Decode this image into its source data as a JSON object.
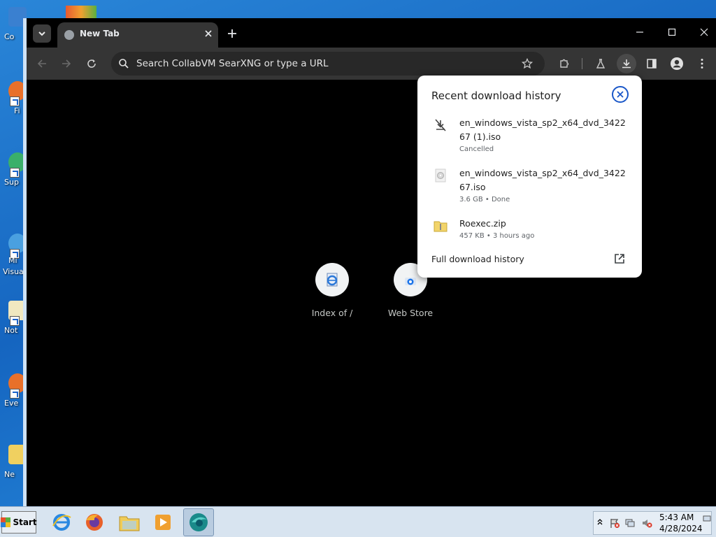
{
  "desktop": {
    "icons": [
      {
        "label": "Co",
        "color": "#3a80d0"
      },
      {
        "label": "Fi",
        "color": "#e8702a"
      },
      {
        "label": "Sup",
        "color": "#3ab06a"
      },
      {
        "label": "Mi",
        "color": "#4aa0e0",
        "label2": "Visua"
      },
      {
        "label": "Not",
        "color": "#f0e8c0"
      },
      {
        "label": "Eve",
        "color": "#e8702a"
      },
      {
        "label": "Ne",
        "color": "#f0d060"
      }
    ]
  },
  "browser": {
    "tab": {
      "title": "New Tab"
    },
    "toolbar": {
      "omnibox_placeholder": "Search CollabVM SearXNG or type a URL"
    },
    "shortcuts": [
      {
        "label": "Index of /"
      },
      {
        "label": "Web Store"
      }
    ]
  },
  "downloads": {
    "title": "Recent download history",
    "items": [
      {
        "name": "en_windows_vista_sp2_x64_dvd_342267 (1).iso",
        "status": "Cancelled"
      },
      {
        "name": "en_windows_vista_sp2_x64_dvd_342267.iso",
        "status": "3.6 GB • Done"
      },
      {
        "name": "Roexec.zip",
        "status": "457 KB • 3 hours ago"
      }
    ],
    "full_history": "Full download history"
  },
  "taskbar": {
    "start_label": "Start",
    "clock_time": "5:43 AM",
    "clock_date": "4/28/2024"
  }
}
